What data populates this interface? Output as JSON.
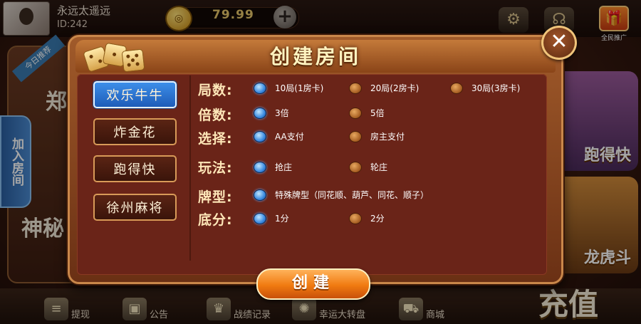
{
  "header": {
    "username": "永远太遥远",
    "user_id": "ID:242",
    "coin_symbol": "◎",
    "coins": "79.99",
    "add_label": "+"
  },
  "promo": {
    "label": "全民推广"
  },
  "lobby": {
    "recommend_ribbon": "今日推荐",
    "left_text_top": "郑",
    "left_text_bottom": "神秘",
    "join_room": "加入房间",
    "right_card_1": "跑得快",
    "right_card_2": "龙虎斗"
  },
  "bottom_nav": [
    {
      "label": "提现",
      "icon": "coins-stack-icon"
    },
    {
      "label": "公告",
      "icon": "briefcase-icon"
    },
    {
      "label": "战绩记录",
      "icon": "trophy-icon"
    },
    {
      "label": "幸运大转盘",
      "icon": "wheel-icon"
    },
    {
      "label": "商城",
      "icon": "cart-icon"
    }
  ],
  "recharge": "充值",
  "modal": {
    "title": "创建房间",
    "close_label": "✕",
    "game_tabs": [
      {
        "label": "欢乐牛牛",
        "active": true
      },
      {
        "label": "炸金花",
        "active": false
      },
      {
        "label": "跑得快",
        "active": false
      },
      {
        "label": "徐州麻将",
        "active": false
      }
    ],
    "rows": {
      "rounds": {
        "label": "局数:",
        "options": [
          "10局(1房卡)",
          "20局(2房卡)",
          "30局(3房卡)"
        ],
        "selected": 0
      },
      "multiplier": {
        "label": "倍数:",
        "options": [
          "3倍",
          "5倍"
        ],
        "selected": 0
      },
      "choice": {
        "label": "选择:",
        "options": [
          "AA支付",
          "房主支付"
        ],
        "selected": 0
      },
      "mode": {
        "label": "玩法:",
        "options": [
          "抢庄",
          "轮庄"
        ],
        "selected": 0
      },
      "cardtype": {
        "label": "牌型:",
        "options": [
          "特殊牌型（同花顺、葫芦、同花、顺子）"
        ],
        "selected": 0
      },
      "base": {
        "label": "底分:",
        "options": [
          "1分",
          "2分"
        ],
        "selected": 0
      }
    },
    "create_label": "创建"
  },
  "colors": {
    "active_tab": "#3d8ee8",
    "modal_bg": "#6a2418",
    "label_text": "#ffe7b8",
    "create_button": "#f07a10"
  }
}
